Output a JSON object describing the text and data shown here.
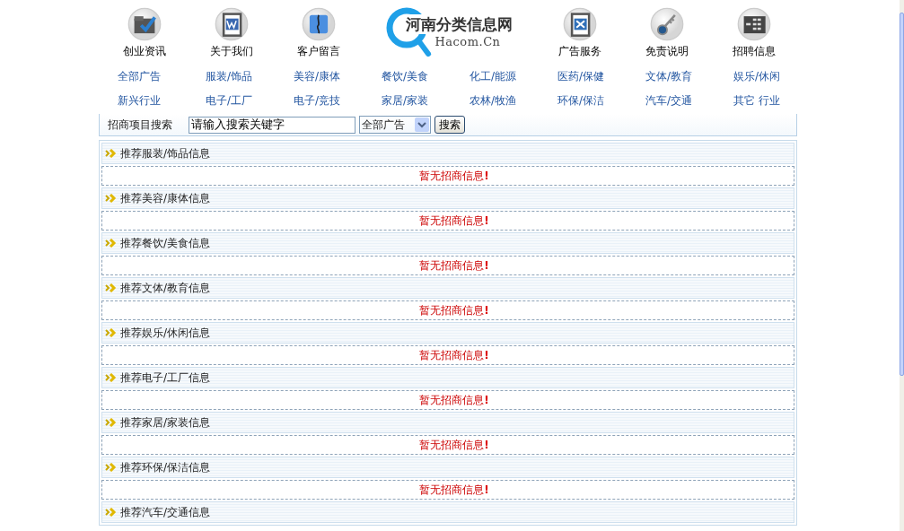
{
  "nav_left": [
    {
      "label": "创业资讯"
    },
    {
      "label": "关于我们"
    },
    {
      "label": "客户留言"
    }
  ],
  "logo": {
    "title": "河南分类信息网",
    "subtitle": "Hacom.Cn"
  },
  "nav_right": [
    {
      "label": "广告服务"
    },
    {
      "label": "免责说明"
    },
    {
      "label": "招聘信息"
    }
  ],
  "categories": [
    [
      "全部广告",
      "服装/饰品",
      "美容/康体",
      "餐饮/美食",
      "化工/能源",
      "医药/保健",
      "文体/教育",
      "娱乐/休闲"
    ],
    [
      "新兴行业",
      "电子/工厂",
      "电子/竞技",
      "家居/家装",
      "农林/牧渔",
      "环保/保洁",
      "汽车/交通",
      "其它 行业"
    ]
  ],
  "search": {
    "label": "招商项目搜索",
    "value": "请输入搜索关键字",
    "select": "全部广告",
    "button": "搜索"
  },
  "sections": [
    {
      "title": "推荐服装/饰品信息",
      "notice": "暂无招商信息",
      "mark": "!"
    },
    {
      "title": "推荐美容/康体信息",
      "notice": "暂无招商信息",
      "mark": "!"
    },
    {
      "title": "推荐餐饮/美食信息",
      "notice": "暂无招商信息",
      "mark": "!"
    },
    {
      "title": "推荐文体/教育信息",
      "notice": "暂无招商信息",
      "mark": "!"
    },
    {
      "title": "推荐娱乐/休闲信息",
      "notice": "暂无招商信息",
      "mark": "!"
    },
    {
      "title": "推荐电子/工厂信息",
      "notice": "暂无招商信息",
      "mark": "!"
    },
    {
      "title": "推荐家居/家装信息",
      "notice": "暂无招商信息",
      "mark": "!"
    },
    {
      "title": "推荐环保/保洁信息",
      "notice": "暂无招商信息",
      "mark": "!"
    },
    {
      "title": "推荐汽车/交通信息"
    }
  ]
}
